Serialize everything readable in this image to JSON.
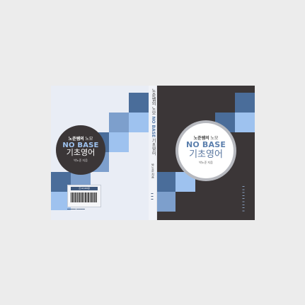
{
  "book": {
    "series_prefix": "노준쌤의",
    "series_suffix": "노모",
    "title_en": "NO BASE",
    "subtitle_kr": "기초영어",
    "author": "박노준 지음"
  },
  "back": {
    "barcode_label": "값 18,000원"
  },
  "colors": {
    "dark": "#3b3637",
    "accent_blue": "#5b7fad",
    "light_blue": "#9ec2ef",
    "mid_blue": "#7d9fcc",
    "back_bg": "#e9edf5"
  }
}
